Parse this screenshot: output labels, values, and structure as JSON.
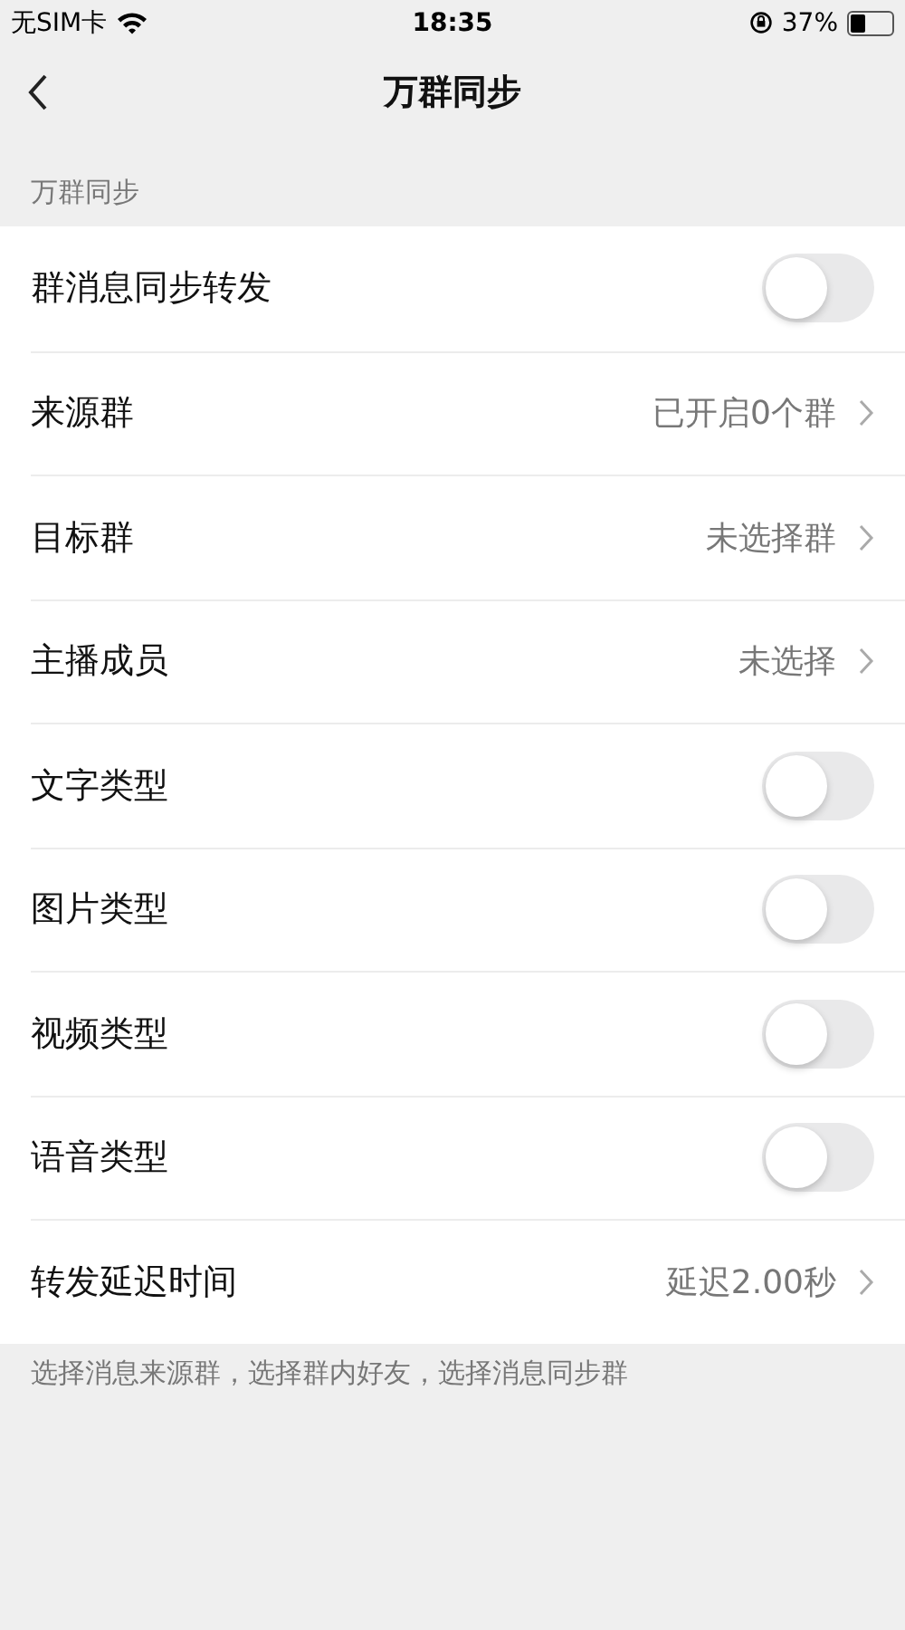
{
  "status_bar": {
    "carrier": "无SIM卡",
    "time": "18:35",
    "battery": "37%"
  },
  "nav": {
    "title": "万群同步"
  },
  "section": {
    "header": "万群同步",
    "footer": "选择消息来源群，选择群内好友，选择消息同步群"
  },
  "rows": [
    {
      "kind": "toggle",
      "label": "群消息同步转发",
      "on": false
    },
    {
      "kind": "link",
      "label": "来源群",
      "value": "已开启0个群"
    },
    {
      "kind": "link",
      "label": "目标群",
      "value": "未选择群"
    },
    {
      "kind": "link",
      "label": "主播成员",
      "value": "未选择"
    },
    {
      "kind": "toggle",
      "label": "文字类型",
      "on": false
    },
    {
      "kind": "toggle",
      "label": "图片类型",
      "on": false
    },
    {
      "kind": "toggle",
      "label": "视频类型",
      "on": false
    },
    {
      "kind": "toggle",
      "label": "语音类型",
      "on": false
    },
    {
      "kind": "link",
      "label": "转发延迟时间",
      "value": "延迟2.00秒"
    }
  ]
}
